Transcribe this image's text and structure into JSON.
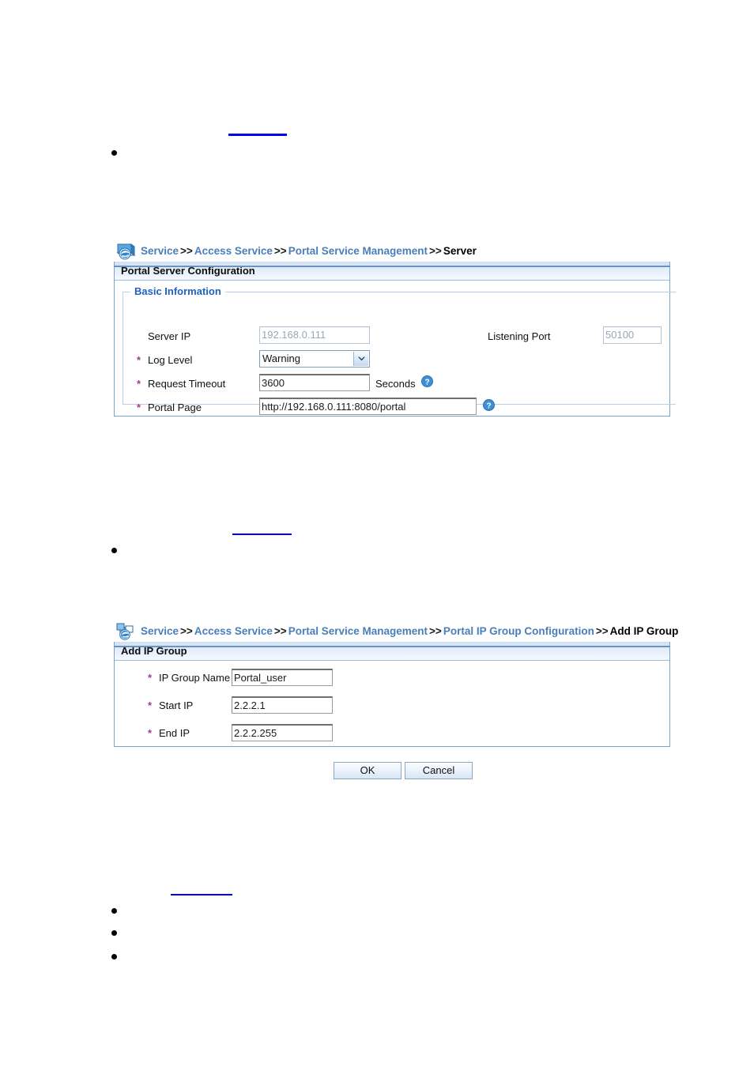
{
  "document": {
    "links": [
      {
        "id": "link-1"
      },
      {
        "id": "link-2"
      },
      {
        "id": "link-3"
      }
    ],
    "bullets": [
      {
        "id": "bullet-1"
      },
      {
        "id": "bullet-2"
      },
      {
        "id": "bullet-3"
      },
      {
        "id": "bullet-4"
      },
      {
        "id": "bullet-5"
      }
    ]
  },
  "colors": {
    "breadcrumb_link": "#4a7ebb",
    "legend_blue": "#1f61c0",
    "required_star": "#a03a9a",
    "panel_border": "#7ba2cd",
    "doc_link": "#0000ee",
    "help_icon": "#3d8fd6"
  },
  "screenshot_one": {
    "breadcrumb": {
      "icon": "portal-service-icon",
      "items": [
        {
          "label": "Service",
          "type": "link"
        },
        {
          "label": "Access Service",
          "type": "link"
        },
        {
          "label": "Portal Service Management",
          "type": "link"
        },
        {
          "label": "Server",
          "type": "current"
        }
      ],
      "separator": ">>"
    },
    "panel_title": "Portal Server Configuration",
    "fieldset_legend": "Basic Information",
    "fields": {
      "server_ip": {
        "label": "Server IP",
        "value": "192.168.0.111",
        "required": false,
        "disabled": true
      },
      "listening_port": {
        "label": "Listening Port",
        "value": "50100",
        "required": false,
        "disabled": true
      },
      "log_level": {
        "label": "Log Level",
        "value": "Warning",
        "required": true,
        "options": [
          "Warning"
        ]
      },
      "request_timeout": {
        "label": "Request Timeout",
        "value": "3600",
        "unit": "Seconds",
        "required": true,
        "help": "help-icon"
      },
      "portal_page": {
        "label": "Portal Page",
        "value": "http://192.168.0.111:8080/portal",
        "required": true,
        "help": "help-icon"
      }
    },
    "required_marker": "*"
  },
  "screenshot_two": {
    "breadcrumb": {
      "icon": "portal-ip-group-icon",
      "items": [
        {
          "label": "Service",
          "type": "link"
        },
        {
          "label": "Access Service",
          "type": "link"
        },
        {
          "label": "Portal Service Management",
          "type": "link"
        },
        {
          "label": "Portal IP Group Configuration",
          "type": "link"
        },
        {
          "label": "Add IP Group",
          "type": "current"
        }
      ],
      "separator": ">>"
    },
    "panel_title": "Add IP Group",
    "fields": {
      "ip_group_name": {
        "label": "IP Group Name",
        "value": "Portal_user",
        "required": true
      },
      "start_ip": {
        "label": "Start IP",
        "value": "2.2.2.1",
        "required": true
      },
      "end_ip": {
        "label": "End IP",
        "value": "2.2.2.255",
        "required": true
      }
    },
    "required_marker": "*",
    "buttons": {
      "ok": "OK",
      "cancel": "Cancel"
    }
  }
}
